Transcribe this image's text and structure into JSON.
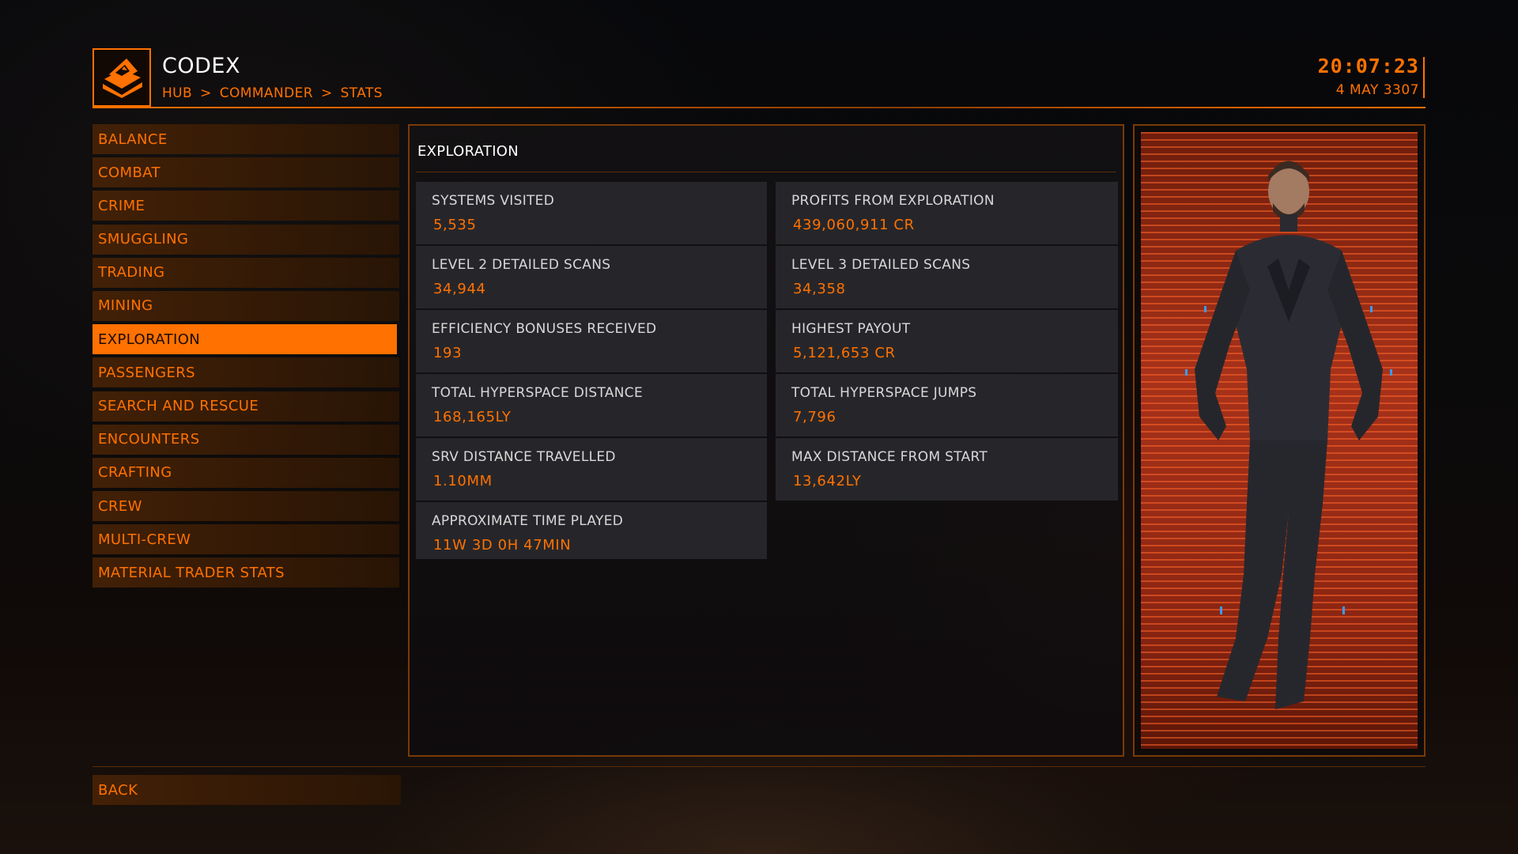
{
  "header": {
    "title": "CODEX",
    "breadcrumb": [
      "HUB",
      ">",
      "COMMANDER",
      ">",
      "STATS"
    ],
    "time": "20:07:23",
    "date": "4 MAY 3307",
    "logo_icon": "codex-book-icon",
    "accent_color": "#ff7100"
  },
  "sidebar": {
    "items": [
      {
        "label": "BALANCE"
      },
      {
        "label": "COMBAT"
      },
      {
        "label": "CRIME"
      },
      {
        "label": "SMUGGLING"
      },
      {
        "label": "TRADING"
      },
      {
        "label": "MINING"
      },
      {
        "label": "EXPLORATION",
        "active": true
      },
      {
        "label": "PASSENGERS"
      },
      {
        "label": "SEARCH AND RESCUE"
      },
      {
        "label": "ENCOUNTERS"
      },
      {
        "label": "CRAFTING"
      },
      {
        "label": "CREW"
      },
      {
        "label": "MULTI-CREW"
      },
      {
        "label": "MATERIAL TRADER STATS"
      }
    ]
  },
  "main": {
    "section_title": "EXPLORATION",
    "stats": [
      {
        "label": "SYSTEMS VISITED",
        "value": "5,535"
      },
      {
        "label": "PROFITS FROM EXPLORATION",
        "value": "439,060,911 CR"
      },
      {
        "label": "LEVEL 2 DETAILED SCANS",
        "value": "34,944"
      },
      {
        "label": "LEVEL 3 DETAILED SCANS",
        "value": "34,358"
      },
      {
        "label": "EFFICIENCY BONUSES RECEIVED",
        "value": "193"
      },
      {
        "label": "HIGHEST PAYOUT",
        "value": "5,121,653 CR"
      },
      {
        "label": "TOTAL HYPERSPACE DISTANCE",
        "value": "168,165LY"
      },
      {
        "label": "TOTAL HYPERSPACE JUMPS",
        "value": "7,796"
      },
      {
        "label": "SRV DISTANCE TRAVELLED",
        "value": "1.10MM"
      },
      {
        "label": "MAX DISTANCE FROM START",
        "value": "13,642LY"
      },
      {
        "label": "APPROXIMATE TIME PLAYED",
        "value": "11W 3D 0H 47MIN"
      }
    ]
  },
  "footer": {
    "back_label": "BACK"
  }
}
